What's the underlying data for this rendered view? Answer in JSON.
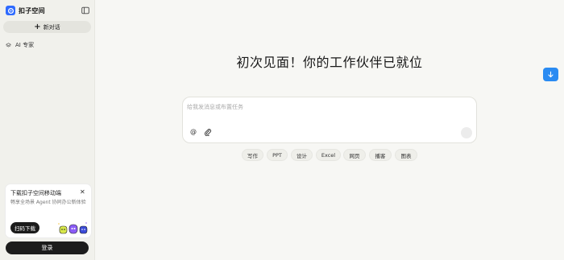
{
  "app": {
    "name": "扣子空间"
  },
  "sidebar": {
    "new_chat_label": "新对话",
    "items": [
      {
        "label": "AI 专家",
        "icon": "layers-icon"
      }
    ],
    "promo": {
      "title": "下载扣子空间移动端",
      "description": "畅享全场景 Agent 协同办公新体验",
      "button_label": "扫码下载"
    },
    "login_label": "登录"
  },
  "main": {
    "headline": "初次见面！你的工作伙伴已就位",
    "composer": {
      "placeholder": "给我发消息或布置任务",
      "value": ""
    },
    "chips": [
      "写作",
      "PPT",
      "设计",
      "Excel",
      "网页",
      "播客",
      "图表"
    ]
  },
  "colors": {
    "accent": "#2a8bf2",
    "logo": "#2f6bff",
    "dark_button": "#1c1c1c",
    "background": "#f7f7f4",
    "sidebar_bg": "#f1f1ec"
  }
}
